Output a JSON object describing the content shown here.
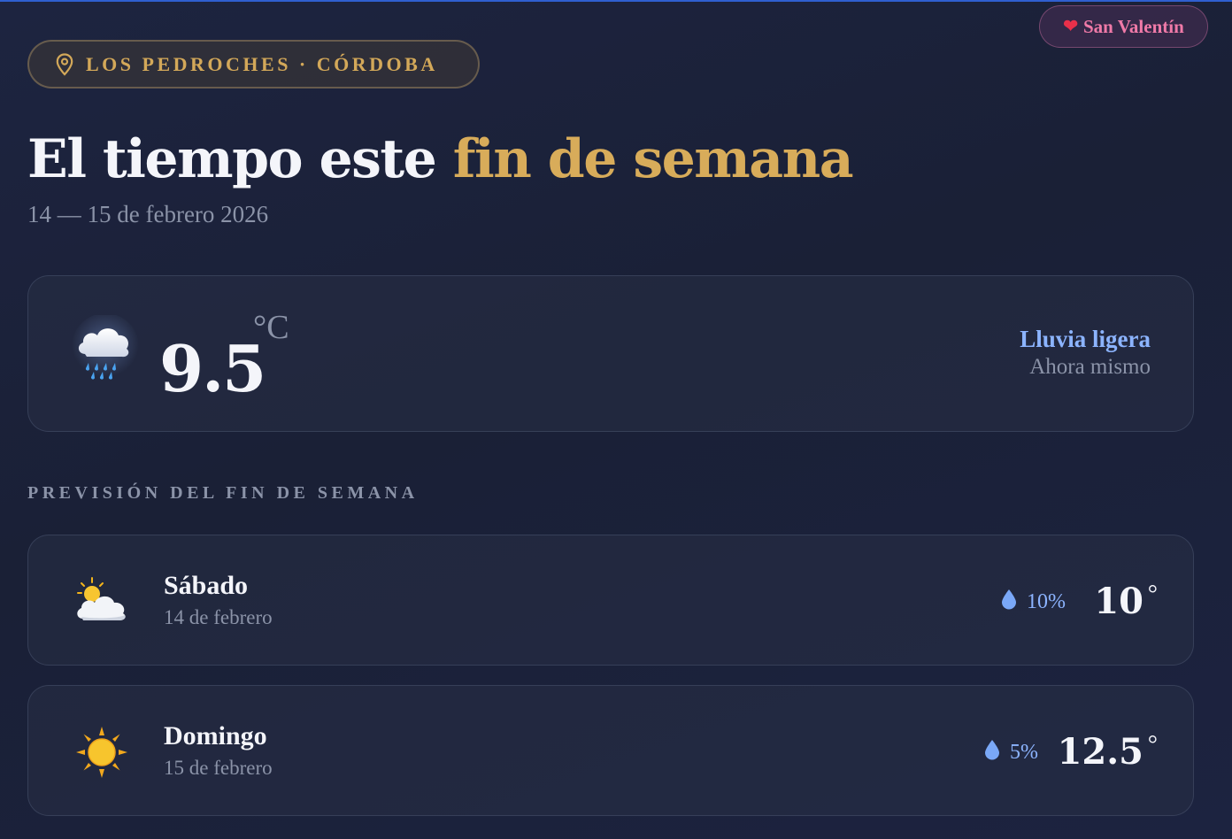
{
  "badge": {
    "icon": "heart-icon",
    "label": "San Valentín"
  },
  "location": {
    "icon": "map-pin-icon",
    "label": "LOS PEDROCHES · CÓRDOBA"
  },
  "header": {
    "title_main": "El tiempo este",
    "title_accent": "fin de semana",
    "dates": "14 — 15 de febrero 2026"
  },
  "current": {
    "icon": "cloud-rain-icon",
    "temperature": "9.5",
    "unit": "°C",
    "condition": "Lluvia ligera",
    "time_label": "Ahora mismo"
  },
  "forecast": {
    "section_label": "PREVISIÓN DEL FIN DE SEMANA",
    "days": [
      {
        "icon": "sun-behind-cloud-icon",
        "name": "Sábado",
        "date": "14 de febrero",
        "rain_chance": "10%",
        "temperature": "10",
        "degree": "°"
      },
      {
        "icon": "sun-icon",
        "name": "Domingo",
        "date": "15 de febrero",
        "rain_chance": "5%",
        "temperature": "12.5",
        "degree": "°"
      }
    ]
  },
  "colors": {
    "background": "#1b2139",
    "accent_gold": "#d8ac5a",
    "accent_blue": "#8cb4ff",
    "valentine_pink": "#f07aa8",
    "muted_text": "#8b93a8"
  }
}
